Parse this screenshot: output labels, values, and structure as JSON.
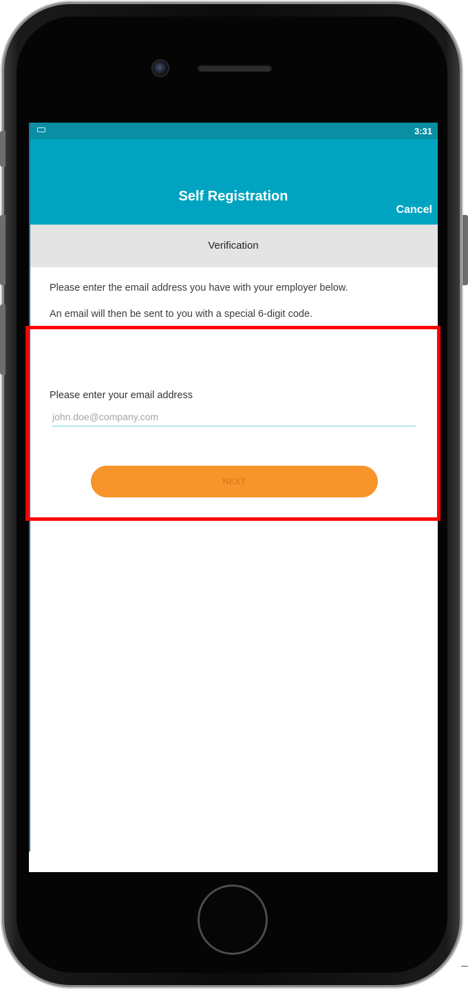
{
  "status_bar": {
    "time": "3:31"
  },
  "header": {
    "title": "Self Registration",
    "cancel_label": "Cancel"
  },
  "sub_header": {
    "title": "Verification"
  },
  "instructions": {
    "line1": "Please enter the email address you have with your employer below.",
    "line2": "An email will then be sent to you with a special 6-digit code."
  },
  "form": {
    "email_label": "Please enter your email address",
    "email_value": "",
    "email_placeholder": "john.doe@company.com",
    "next_label": "NEXT"
  },
  "colors": {
    "status_bar": "#0a8ea3",
    "header": "#00a4c0",
    "sub_header": "#e4e4e4",
    "button": "#f7952a",
    "input_underline": "#6fd0e0",
    "highlight": "#ff0000"
  },
  "icons": {
    "status_left": "notification-icon"
  }
}
